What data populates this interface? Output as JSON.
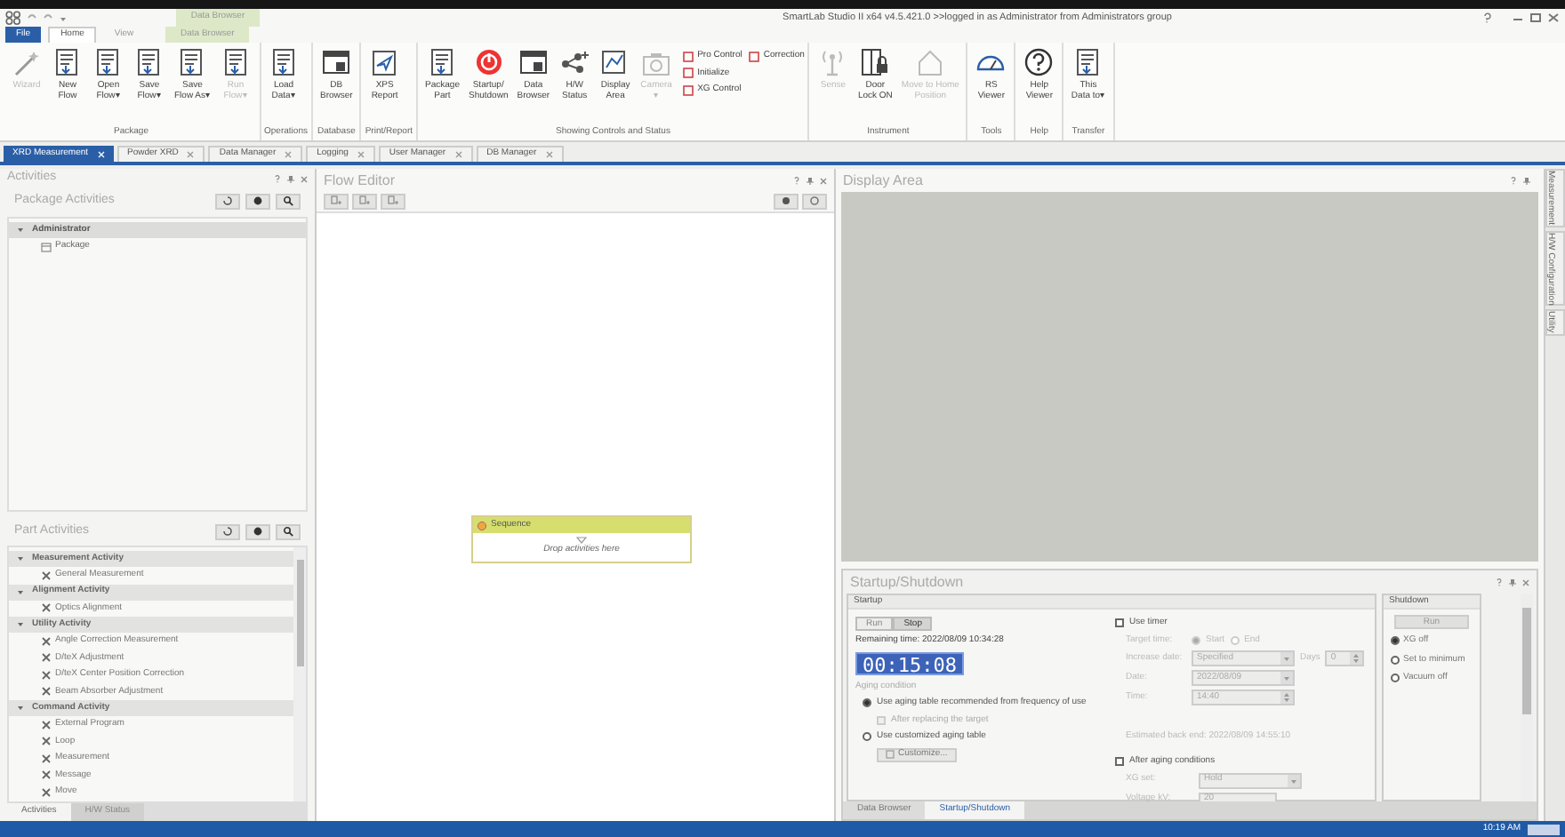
{
  "window": {
    "title": "SmartLab Studio II x64 v4.5.421.0 >>logged in as Administrator from Administrators group",
    "context_label": "Data Browser"
  },
  "ribbon_tabs": [
    {
      "label": "File",
      "kind": "file",
      "selected": false
    },
    {
      "label": "Home",
      "kind": "tab",
      "selected": true
    },
    {
      "label": "View",
      "kind": "tab",
      "selected": false
    },
    {
      "label": "Data Browser",
      "kind": "context",
      "selected": false
    }
  ],
  "ribbon": {
    "groups": [
      {
        "label": "Package",
        "buttons": [
          {
            "lines": [
              "Wizard"
            ],
            "kind": "wand",
            "disabled": true
          },
          {
            "lines": [
              "New",
              "Flow"
            ],
            "kind": "doc",
            "disabled": false
          },
          {
            "lines": [
              "Open",
              "Flow▾"
            ],
            "kind": "doc",
            "disabled": false
          },
          {
            "lines": [
              "Save",
              "Flow▾"
            ],
            "kind": "doc",
            "disabled": false
          },
          {
            "lines": [
              "Save",
              "Flow As▾"
            ],
            "kind": "doc",
            "disabled": false
          },
          {
            "lines": [
              "Run",
              "Flow▾"
            ],
            "kind": "doc",
            "disabled": true
          }
        ]
      },
      {
        "label": "Operations",
        "buttons": [
          {
            "lines": [
              "Load",
              "Data▾"
            ],
            "kind": "doc",
            "disabled": false
          }
        ]
      },
      {
        "label": "Database",
        "buttons": [
          {
            "lines": [
              "DB",
              "Browser"
            ],
            "kind": "window",
            "disabled": false
          }
        ]
      },
      {
        "label": "Print/Report",
        "buttons": [
          {
            "lines": [
              "XPS",
              "Report"
            ],
            "kind": "plane",
            "disabled": false
          }
        ]
      },
      {
        "label": "Showing Controls and Status",
        "buttons": [
          {
            "lines": [
              "Package",
              "Part"
            ],
            "kind": "doc",
            "disabled": false
          },
          {
            "lines": [
              "Startup/",
              "Shutdown"
            ],
            "kind": "power",
            "disabled": false
          },
          {
            "lines": [
              "Data",
              "Browser"
            ],
            "kind": "window",
            "disabled": false
          },
          {
            "lines": [
              "H/W",
              "Status"
            ],
            "kind": "network",
            "disabled": false
          },
          {
            "lines": [
              "Display",
              "Area"
            ],
            "kind": "chart",
            "disabled": false
          },
          {
            "lines": [
              "Camera",
              "▾"
            ],
            "kind": "camera",
            "disabled": true
          }
        ],
        "small_rows": [
          [
            {
              "label": "Pro Control"
            },
            {
              "label": "Correction"
            }
          ],
          [
            {
              "label": "Initialize"
            }
          ],
          [
            {
              "label": "XG Control"
            }
          ]
        ]
      },
      {
        "label": "Instrument",
        "buttons": [
          {
            "lines": [
              "Sense"
            ],
            "kind": "antenna",
            "disabled": true
          },
          {
            "lines": [
              "Door",
              "Lock ON"
            ],
            "kind": "door",
            "disabled": false
          },
          {
            "lines": [
              "Move to Home",
              "Position"
            ],
            "kind": "home",
            "disabled": true
          }
        ]
      },
      {
        "label": "Tools",
        "buttons": [
          {
            "lines": [
              "RS",
              "Viewer"
            ],
            "kind": "gauge",
            "disabled": false
          }
        ]
      },
      {
        "label": "Help",
        "buttons": [
          {
            "lines": [
              "Help",
              "Viewer"
            ],
            "kind": "help",
            "disabled": false
          }
        ]
      },
      {
        "label": "Transfer",
        "buttons": [
          {
            "lines": [
              "This",
              "Data to▾"
            ],
            "kind": "doc",
            "disabled": false
          }
        ]
      }
    ]
  },
  "doc_tabs": [
    {
      "label": "XRD Measurement",
      "selected": true
    },
    {
      "label": "Powder XRD",
      "selected": false
    },
    {
      "label": "Data Manager",
      "selected": false
    },
    {
      "label": "Logging",
      "selected": false
    },
    {
      "label": "User Manager",
      "selected": false
    },
    {
      "label": "DB Manager",
      "selected": false
    }
  ],
  "activities": {
    "title": "Activities",
    "package": {
      "title": "Package Activities",
      "tree": [
        {
          "label": "Administrator",
          "expanded": true,
          "selected": true,
          "children": [
            {
              "label": "Package"
            }
          ]
        }
      ]
    },
    "part": {
      "title": "Part Activities",
      "tree": [
        {
          "label": "Measurement Activity",
          "expanded": true,
          "children": [
            {
              "label": "General Measurement"
            }
          ]
        },
        {
          "label": "Alignment Activity",
          "expanded": true,
          "children": [
            {
              "label": "Optics Alignment"
            }
          ]
        },
        {
          "label": "Utility Activity",
          "expanded": true,
          "children": [
            {
              "label": "Angle Correction Measurement"
            },
            {
              "label": "D/teX Adjustment"
            },
            {
              "label": "D/teX Center Position Correction"
            },
            {
              "label": "Beam Absorber Adjustment"
            }
          ]
        },
        {
          "label": "Command Activity",
          "expanded": true,
          "children": [
            {
              "label": "External Program"
            },
            {
              "label": "Loop"
            },
            {
              "label": "Measurement"
            },
            {
              "label": "Message"
            },
            {
              "label": "Move"
            }
          ]
        }
      ]
    },
    "tabs": [
      {
        "label": "Activities",
        "selected": true
      },
      {
        "label": "H/W Status",
        "selected": false
      }
    ]
  },
  "flow_editor": {
    "title": "Flow Editor",
    "sequence": {
      "title": "Sequence",
      "hint": "Drop activities here"
    }
  },
  "display_area": {
    "title": "Display Area"
  },
  "side_tabs": [
    {
      "label": "Measurement"
    },
    {
      "label": "H/W Configuration"
    },
    {
      "label": "Utility"
    }
  ],
  "startup_shutdown": {
    "title": "Startup/Shutdown",
    "startup": {
      "title": "Startup",
      "buttons": [
        {
          "label": "Run",
          "selected": false
        },
        {
          "label": "Stop",
          "selected": true
        }
      ],
      "remaining": "Remaining time: 2022/08/09 10:34:28",
      "timer": "00:15:08",
      "aging_title": "Aging condition",
      "aging_options": [
        {
          "kind": "radio",
          "label": "Use aging table recommended from frequency of use",
          "selected": true,
          "disabled": false
        },
        {
          "kind": "checkbox",
          "label": "After replacing the target",
          "checked": false,
          "disabled": true
        },
        {
          "kind": "radio",
          "label": "Use customized aging table",
          "selected": false,
          "disabled": false
        }
      ],
      "customize_button": {
        "label": "Customize...",
        "disabled": true
      },
      "use_timer": {
        "label": "Use timer",
        "checked": false
      },
      "target_time": {
        "label": "Target time:",
        "options": [
          {
            "label": "Start",
            "selected": true
          },
          {
            "label": "End",
            "selected": false
          }
        ]
      },
      "timer_fields": [
        {
          "kind": "dropdown",
          "label": "Increase date:",
          "value": "Specified",
          "extra": {
            "label": "Days",
            "value": "0"
          }
        },
        {
          "kind": "dropdown",
          "label": "Date:",
          "value": "2022/08/09"
        },
        {
          "kind": "spin",
          "label": "Time:",
          "value": "14:40"
        }
      ],
      "estimate": "Estimated back end: 2022/08/09 14:55:10",
      "after_aging": {
        "label": "After aging conditions",
        "checked": false
      },
      "after_fields": [
        {
          "kind": "dropdown",
          "label": "XG set:",
          "value": "Hold"
        },
        {
          "kind": "text",
          "label": "Voltage kV:",
          "value": "20"
        }
      ]
    },
    "shutdown": {
      "title": "Shutdown",
      "button": "Run",
      "options": [
        {
          "label": "XG off",
          "selected": true
        },
        {
          "label": "Set to minimum",
          "selected": false
        },
        {
          "label": "Vacuum off",
          "selected": false
        }
      ]
    },
    "tabs": [
      {
        "label": "Data Browser",
        "selected": false
      },
      {
        "label": "Startup/Shutdown",
        "selected": true
      }
    ]
  },
  "taskbar": {
    "time": "10:19 AM"
  }
}
